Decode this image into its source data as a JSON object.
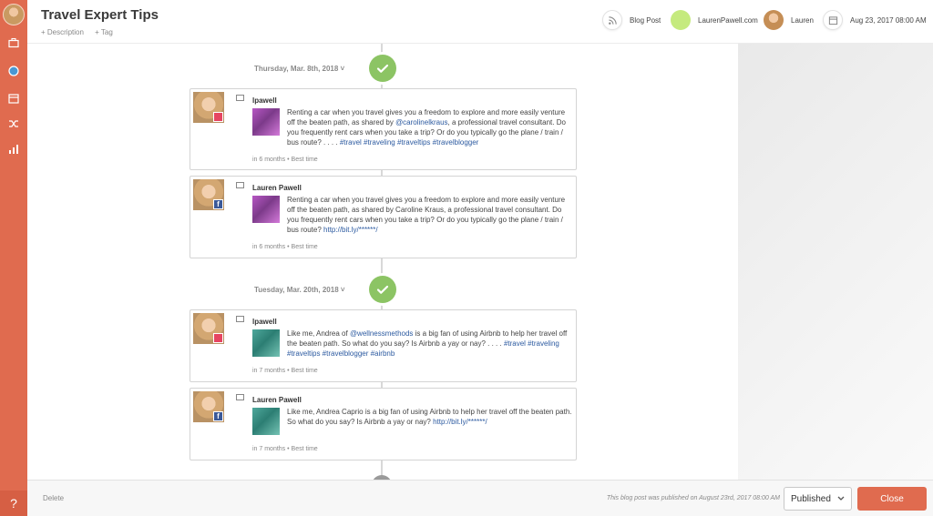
{
  "header": {
    "title": "Travel Expert Tips",
    "add_description": "+ Description",
    "add_tag": "+ Tag",
    "type_label": "Blog Post",
    "site_label": "LaurenPawell.com",
    "user_label": "Lauren",
    "date_label": "Aug 23, 2017 08:00 AM"
  },
  "timeline": {
    "groups": [
      {
        "date": "Thursday, Mar. 8th, 2018 ˅",
        "posts": [
          {
            "network": "instagram",
            "account": "lpawell",
            "text_before": "Renting a car when you travel gives you a freedom to explore and more easily venture off the beaten path, as shared by ",
            "mention": "@carolinelkraus",
            "text_after": ", a professional travel consultant. Do you frequently rent cars when you take a trip? Or do you typically go the plane / train / bus route? . . . . ",
            "hashtags": "#travel #traveling #traveltips #travelblogger",
            "meta": "in 6 months • Best time"
          },
          {
            "network": "facebook",
            "account": "Lauren Pawell",
            "text_before": "Renting a car when you travel gives you a freedom to explore and more easily venture off the beaten path, as shared by Caroline Kraus, a professional travel consultant. Do you frequently rent cars when you take a trip? Or do you typically go the plane / train / bus route? ",
            "link": "http://bit.ly/******/",
            "meta": "in 6 months • Best time"
          }
        ]
      },
      {
        "date": "Tuesday, Mar. 20th, 2018 ˅",
        "posts": [
          {
            "network": "instagram",
            "account": "lpawell",
            "text_before": "Like me, Andrea of ",
            "mention": "@wellnessmethods",
            "text_after": " is a big fan of using Airbnb to help her travel off the beaten path. So what do you say? Is Airbnb a yay or nay? . . . . ",
            "hashtags": "#travel #traveling #traveltips #travelblogger #airbnb",
            "meta": "in 7 months • Best time"
          },
          {
            "network": "facebook",
            "account": "Lauren Pawell",
            "text_before": "Like me, Andrea Caprio is a big fan of using Airbnb to help her travel off the beaten path. So what do you say? Is Airbnb a yay or nay? ",
            "link": "http://bit.ly/******/",
            "meta": "in 7 months • Best time"
          }
        ]
      }
    ]
  },
  "footer": {
    "delete_label": "Delete",
    "published_note": "This blog post was published on August 23rd, 2017 08:00 AM",
    "status_value": "Published",
    "close_label": "Close"
  },
  "colors": {
    "accent": "#e06b4f",
    "check_green": "#8cc464",
    "link_blue": "#2c5aa0"
  }
}
